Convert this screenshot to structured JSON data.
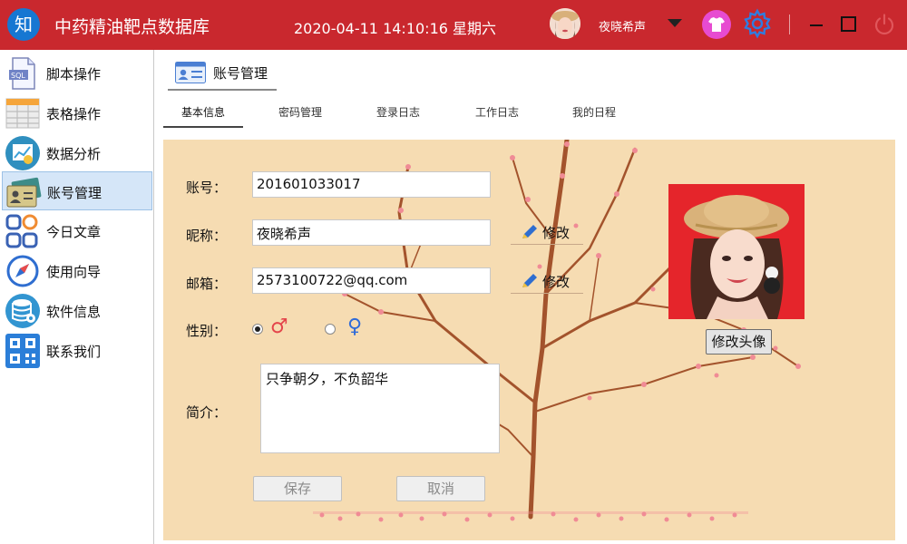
{
  "app": {
    "logo_char": "知",
    "title": "中药精油靶点数据库",
    "datetime": "2020-04-11 14:10:16 星期六",
    "user_name": "夜晓希声"
  },
  "sidebar": {
    "items": [
      {
        "label": "脚本操作",
        "icon": "sql-file-icon"
      },
      {
        "label": "表格操作",
        "icon": "table-icon"
      },
      {
        "label": "数据分析",
        "icon": "chart-icon"
      },
      {
        "label": "账号管理",
        "icon": "id-card-icon",
        "active": true
      },
      {
        "label": "今日文章",
        "icon": "grid-circles-icon"
      },
      {
        "label": "使用向导",
        "icon": "compass-icon"
      },
      {
        "label": "软件信息",
        "icon": "database-icon"
      },
      {
        "label": "联系我们",
        "icon": "qrcode-icon"
      }
    ]
  },
  "main": {
    "page_tab": "账号管理",
    "subtabs": [
      "基本信息",
      "密码管理",
      "登录日志",
      "工作日志",
      "我的日程"
    ],
    "active_subtab": "基本信息"
  },
  "form": {
    "account_label": "账号：",
    "account_value": "201601033017",
    "nickname_label": "昵称：",
    "nickname_value": "夜晓希声",
    "email_label": "邮箱：",
    "email_value": "2573100722@qq.com",
    "edit_label": "修改",
    "gender_label": "性别：",
    "gender_male_symbol": "♂",
    "gender_female_symbol": "♀",
    "gender_selected": "male",
    "bio_label": "简介：",
    "bio_value": "只争朝夕，不负韶华",
    "save_label": "保存",
    "cancel_label": "取消",
    "change_avatar_label": "修改头像"
  },
  "colors": {
    "titlebar": "#c9282e",
    "content_bg": "#f6dcb2",
    "male_icon": "#e4454b",
    "female_icon": "#2f6bd8",
    "blossom": "#f08b95",
    "branch": "#a3532c"
  }
}
